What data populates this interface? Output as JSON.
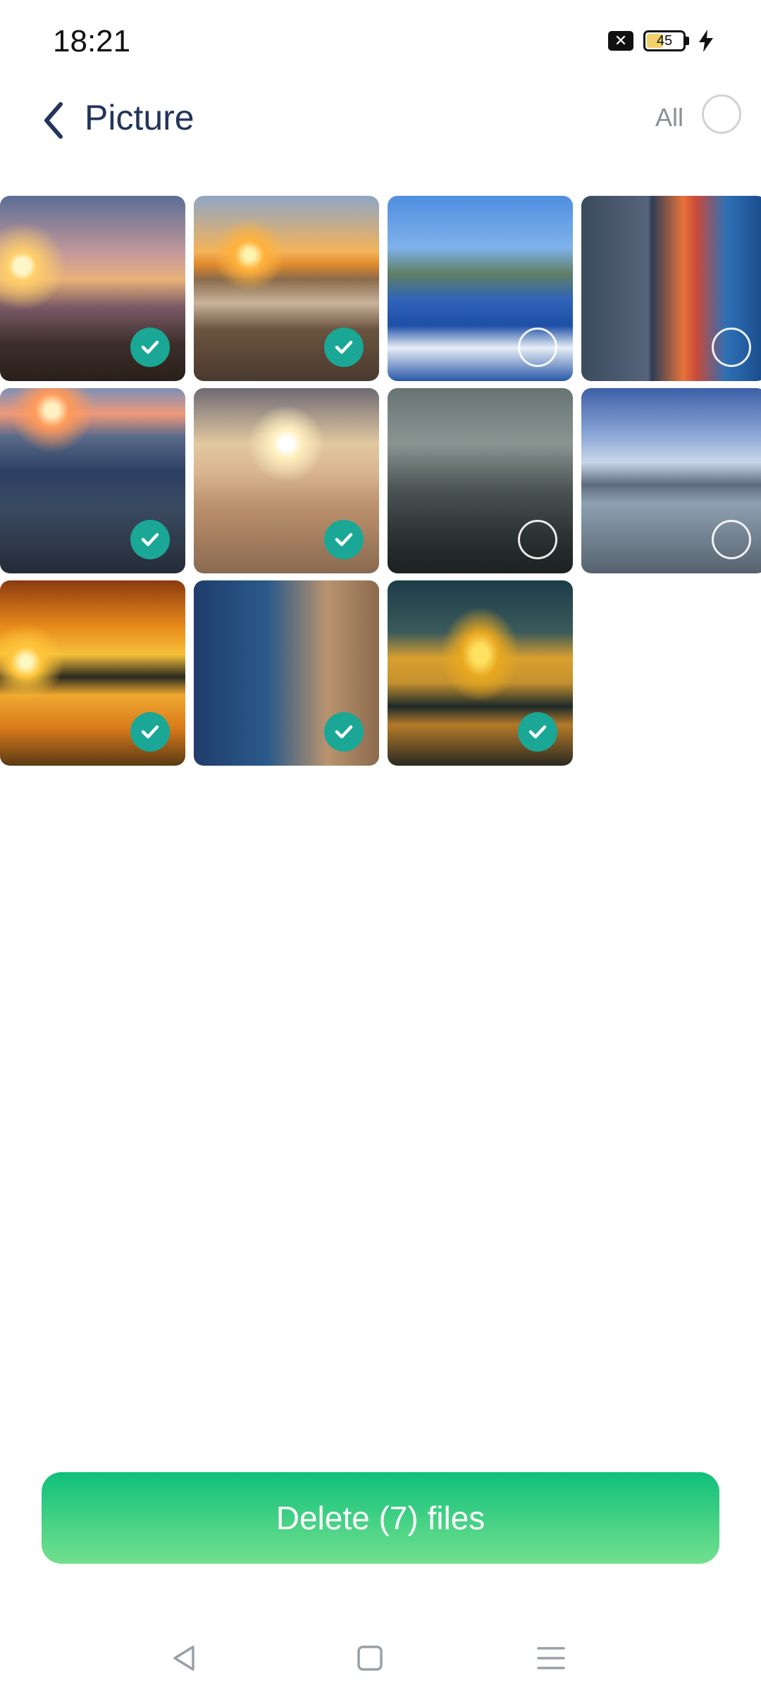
{
  "status": {
    "time": "18:21",
    "battery": "45",
    "battery_level": 0.45
  },
  "header": {
    "title": "Picture",
    "select_all_label": "All",
    "select_all_checked": false
  },
  "images": [
    {
      "scene": "mountain-sunset",
      "selected": true
    },
    {
      "scene": "pier-sunset",
      "selected": true
    },
    {
      "scene": "coast-waves",
      "selected": false
    },
    {
      "scene": "dramatic-sky-sea",
      "selected": false
    },
    {
      "scene": "bay-sunset",
      "selected": true
    },
    {
      "scene": "boardwalk-sunrise",
      "selected": true
    },
    {
      "scene": "robot-scene",
      "selected": false
    },
    {
      "scene": "harbor-boats",
      "selected": false
    },
    {
      "scene": "golden-lake",
      "selected": true
    },
    {
      "scene": "cliff-bay",
      "selected": true
    },
    {
      "scene": "lake-boat-sunset",
      "selected": true
    }
  ],
  "actions": {
    "delete_label": "Delete (7) files"
  },
  "colors": {
    "accent": "#1aa796",
    "delete_top": "#10c07a",
    "delete_bottom": "#73e08e",
    "title": "#22355a"
  },
  "icons": {
    "back": "chevron-left-icon",
    "checked": "checkmark-icon",
    "nav_back": "triangle-back-icon",
    "nav_home": "square-home-icon",
    "nav_recents": "menu-lines-icon"
  }
}
